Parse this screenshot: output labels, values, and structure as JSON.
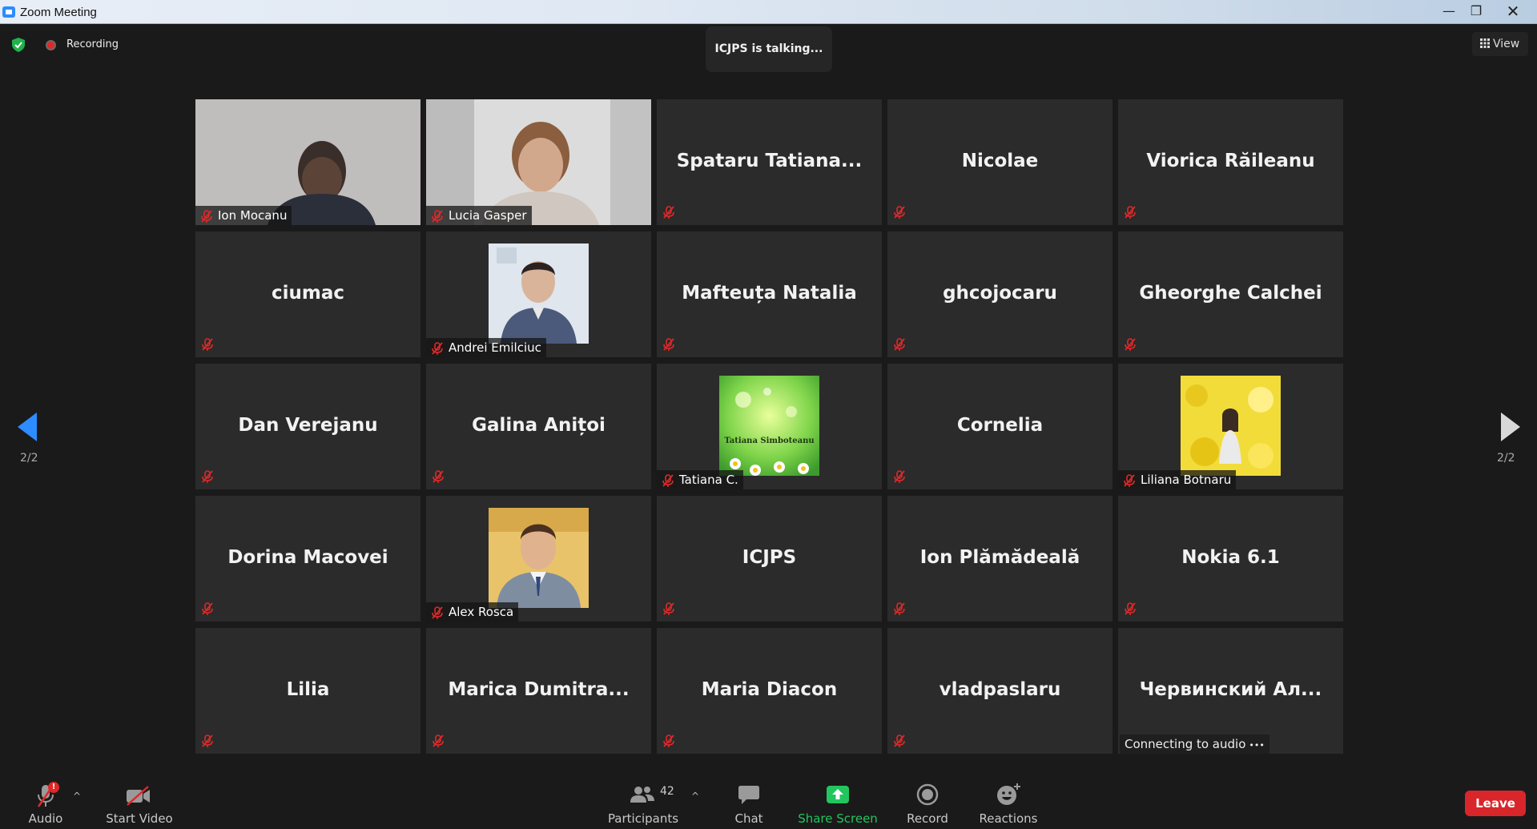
{
  "window": {
    "title": "Zoom Meeting",
    "minimize": "—",
    "maximize": "❐",
    "close": "✕"
  },
  "topbar": {
    "recording_label": "Recording",
    "talking": "ICJPS is talking...",
    "view_label": "View"
  },
  "nav": {
    "page_indicator": "2/2"
  },
  "tiles": [
    {
      "name": "Ion Mocanu",
      "video": true
    },
    {
      "name": "Lucia Gasper",
      "video": true
    },
    {
      "name": "Spataru  Tatiana..."
    },
    {
      "name": "Nicolae"
    },
    {
      "name": "Viorica Răileanu"
    },
    {
      "name": "ciumac"
    },
    {
      "name": "Andrei Emilciuc",
      "picture": true
    },
    {
      "name": "Mafteuța Natalia"
    },
    {
      "name": "ghcojocaru"
    },
    {
      "name": "Gheorghe Calchei"
    },
    {
      "name": "Dan Verejanu"
    },
    {
      "name": "Galina Anițoi"
    },
    {
      "name": "Tatiana C.",
      "picture": true,
      "picture_caption": "Tatiana Simboteanu"
    },
    {
      "name": "Cornelia"
    },
    {
      "name": "Liliana Botnaru",
      "picture": true
    },
    {
      "name": "Dorina Macovei"
    },
    {
      "name": "Alex Rosca",
      "picture": true
    },
    {
      "name": "ICJPS"
    },
    {
      "name": "Ion Plămădeală"
    },
    {
      "name": "Nokia 6.1"
    },
    {
      "name": "Lilia"
    },
    {
      "name": "Marica  Dumitra..."
    },
    {
      "name": "Maria Diacon"
    },
    {
      "name": "vladpaslaru"
    },
    {
      "name": "Червинский  Ал...",
      "status": "Connecting to audio"
    }
  ],
  "toolbar": {
    "audio_label": "Audio",
    "audio_badge": "!",
    "video_label": "Start Video",
    "participants_label": "Participants",
    "participants_count": "42",
    "chat_label": "Chat",
    "share_label": "Share Screen",
    "record_label": "Record",
    "reactions_label": "Reactions",
    "leave_label": "Leave"
  },
  "colors": {
    "accent": "#2d8cff",
    "share_green": "#22c55e",
    "leave_red": "#d8262b",
    "tile_bg": "#2b2b2b"
  }
}
